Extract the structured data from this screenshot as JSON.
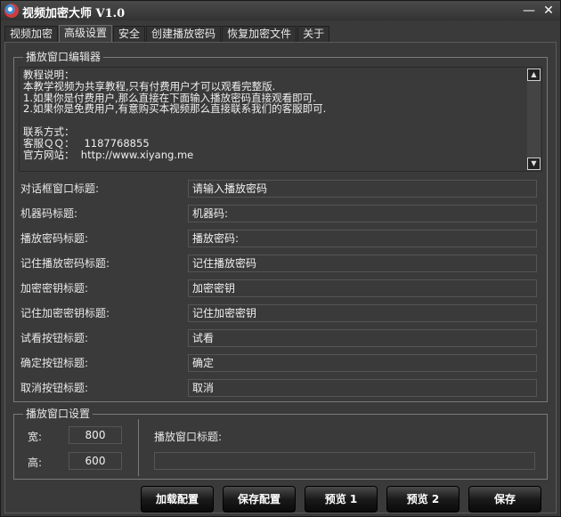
{
  "window": {
    "title": "视频加密大师 V1.0",
    "minimize_glyph": "—",
    "close_glyph": "✕"
  },
  "tabs": [
    {
      "label": "视频加密",
      "active": false
    },
    {
      "label": "高级设置",
      "active": true
    },
    {
      "label": "安全",
      "active": false
    },
    {
      "label": "创建播放密码",
      "active": false
    },
    {
      "label": "恢复加密文件",
      "active": false
    },
    {
      "label": "关于",
      "active": false
    }
  ],
  "editor_group": {
    "label": "播放窗口编辑器"
  },
  "editor": {
    "text": "教程说明：\n本教学视频为共享教程,只有付费用户才可以观看完整版.\n1.如果你是付费用户,那么直接在下面输入播放密码直接观看即可.\n2.如果你是免费用户,有意购买本视频那么直接联系我们的客服即可.\n\n联系方式：\n客服ＱＱ：   1187768855\n官方网站：  http://www.xiyang.me",
    "scroll_up_icon": "scroll-up-arrow",
    "scroll_down_icon": "scroll-down-arrow"
  },
  "fields": [
    {
      "label": "对话框窗口标题:",
      "value": "请输入播放密码"
    },
    {
      "label": "机器码标题:",
      "value": "机器码:"
    },
    {
      "label": "播放密码标题:",
      "value": "播放密码:"
    },
    {
      "label": "记住播放密码标题:",
      "value": "记住播放密码"
    },
    {
      "label": "加密密钥标题:",
      "value": "加密密钥"
    },
    {
      "label": "记住加密密钥标题:",
      "value": "记住加密密钥"
    },
    {
      "label": "试看按钮标题:",
      "value": "试看"
    },
    {
      "label": "确定按钮标题:",
      "value": "确定"
    },
    {
      "label": "取消按钮标题:",
      "value": "取消"
    }
  ],
  "window_settings": {
    "label": "播放窗口设置",
    "width_label": "宽:",
    "width_value": "800",
    "height_label": "高:",
    "height_value": "600",
    "title_label": "播放窗口标题:",
    "title_value": ""
  },
  "buttons": {
    "load": "加载配置",
    "save_config": "保存配置",
    "preview1": "预览 1",
    "preview2": "预览 2",
    "save": "保存"
  },
  "colors": {
    "background": "#3a3a3a",
    "text": "#e8e8e8",
    "border": "#7a7a7a"
  }
}
